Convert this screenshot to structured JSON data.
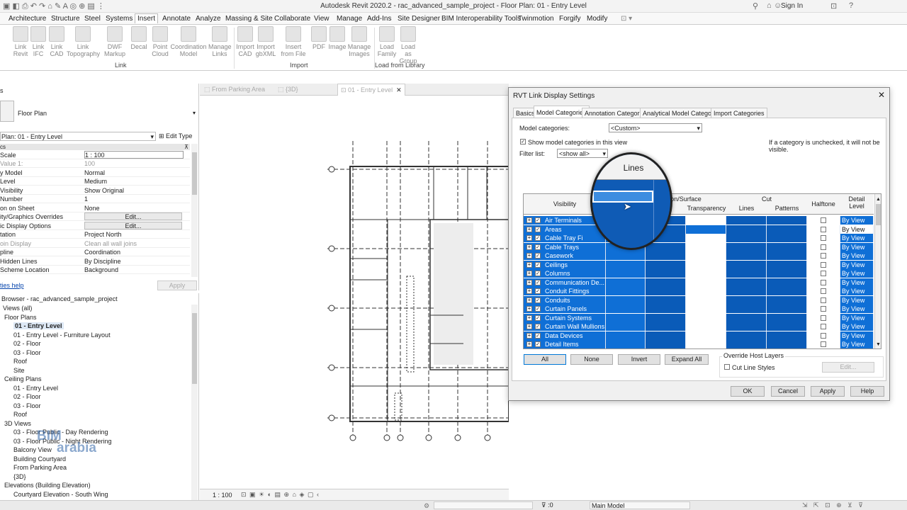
{
  "app": {
    "window_title": "Autodesk Revit 2020.2 - rac_advanced_sample_project - Floor Plan: 01 - Entry Level",
    "sign_in": "Sign In"
  },
  "ribbon_tabs": [
    "Architecture",
    "Structure",
    "Steel",
    "Systems",
    "Insert",
    "Annotate",
    "Analyze",
    "Massing & Site",
    "Collaborate",
    "View",
    "Manage",
    "Add-Ins",
    "Site Designer",
    "BIM Interoperability Tools",
    "Twinmotion",
    "Forgify",
    "Modify"
  ],
  "ribbon": {
    "buttons": [
      {
        "line1": "Link",
        "line2": "Revit"
      },
      {
        "line1": "Link",
        "line2": "IFC"
      },
      {
        "line1": "Link",
        "line2": "CAD"
      },
      {
        "line1": "Link",
        "line2": "Topography"
      },
      {
        "line1": "DWF",
        "line2": "Markup"
      },
      {
        "line1": "Decal",
        "line2": ""
      },
      {
        "line1": "Point",
        "line2": "Cloud"
      },
      {
        "line1": "Coordination",
        "line2": "Model"
      },
      {
        "line1": "Manage",
        "line2": "Links"
      },
      {
        "line1": "Import",
        "line2": "CAD"
      },
      {
        "line1": "Import",
        "line2": "gbXML"
      },
      {
        "line1": "Insert",
        "line2": "from File"
      },
      {
        "line1": "PDF",
        "line2": ""
      },
      {
        "line1": "Image",
        "line2": ""
      },
      {
        "line1": "Manage",
        "line2": "Images"
      },
      {
        "line1": "Load",
        "line2": "Family"
      },
      {
        "line1": "Load as",
        "line2": "Group"
      }
    ],
    "panels": [
      "Link",
      "Import",
      "Load from Library"
    ]
  },
  "properties": {
    "type_name": "Floor Plan",
    "selector": "Plan: 01 - Entry Level",
    "edit_type": "Edit Type",
    "section": "cs",
    "rows": [
      {
        "k": "Scale",
        "v": "1 : 100"
      },
      {
        "k": "Value   1:",
        "v": "100"
      },
      {
        "k": "y Model",
        "v": "Normal"
      },
      {
        "k": "Level",
        "v": "Medium"
      },
      {
        "k": "Visibility",
        "v": "Show Original"
      },
      {
        "k": "Number",
        "v": "1"
      },
      {
        "k": "on on Sheet",
        "v": "None"
      },
      {
        "k": "ity/Graphics Overrides",
        "v": "Edit..."
      },
      {
        "k": "ic Display Options",
        "v": "Edit..."
      },
      {
        "k": "tation",
        "v": "Project North"
      },
      {
        "k": "oin Display",
        "v": "Clean all wall joins"
      },
      {
        "k": "pline",
        "v": "Coordination"
      },
      {
        "k": "Hidden Lines",
        "v": "By Discipline"
      },
      {
        "k": "Scheme Location",
        "v": "Background"
      }
    ],
    "help": "ties help",
    "apply": "Apply"
  },
  "browser": {
    "title": "Browser - rac_advanced_sample_project",
    "nodes": [
      {
        "t": "Views (all)",
        "x": 4
      },
      {
        "t": "Floor Plans",
        "x": 6
      },
      {
        "t": "01 - Entry Level",
        "x": 19,
        "bold": true
      },
      {
        "t": "01 - Entry Level - Furniture Layout",
        "x": 19
      },
      {
        "t": "02 - Floor",
        "x": 19
      },
      {
        "t": "03 - Floor",
        "x": 19
      },
      {
        "t": "Roof",
        "x": 19
      },
      {
        "t": "Site",
        "x": 19
      },
      {
        "t": "Ceiling Plans",
        "x": 6
      },
      {
        "t": "01 - Entry Level",
        "x": 19
      },
      {
        "t": "02 - Floor",
        "x": 19
      },
      {
        "t": "03 - Floor",
        "x": 19
      },
      {
        "t": "Roof",
        "x": 19
      },
      {
        "t": "3D Views",
        "x": 6
      },
      {
        "t": "03 - Floor Public - Day Rendering",
        "x": 19
      },
      {
        "t": "03 - Floor Public - Night Rendering",
        "x": 19
      },
      {
        "t": "Balcony View",
        "x": 19
      },
      {
        "t": "Building Courtyard",
        "x": 19
      },
      {
        "t": "From Parking Area",
        "x": 19
      },
      {
        "t": "{3D}",
        "x": 19
      },
      {
        "t": "Elevations (Building Elevation)",
        "x": 6
      },
      {
        "t": "Courtyard Elevation - South Wing",
        "x": 19
      }
    ],
    "watermark_top": "BIM",
    "watermark_bottom": "arabia"
  },
  "view_tabs": [
    "From Parking Area",
    "{3D}",
    "01 - Entry Level"
  ],
  "view_scale": "1 : 100",
  "status": {
    "main_model": "Main Model",
    "zero": ":0"
  },
  "dialog": {
    "title": "RVT Link Display Settings",
    "tabs": [
      "Basics",
      "Model Categories",
      "Annotation Categories",
      "Analytical Model Categories",
      "Import Categories"
    ],
    "model_categories_label": "Model categories:",
    "model_categories_value": "<Custom>",
    "show_categories_label": "Show model categories in this view",
    "hint": "If a category is unchecked, it will not be visible.",
    "filter_label": "Filter list:",
    "filter_value": "<show all>",
    "headers": {
      "visibility": "Visibility",
      "projection": "on/Surface",
      "lines": "Lines",
      "patterns": "ns",
      "transparency": "Transparency",
      "cut": "Cut",
      "cut_lines": "Lines",
      "cut_patterns": "Patterns",
      "halftone": "Halftone",
      "detail_level": "Detail Level"
    },
    "rows": [
      {
        "name": "Air Terminals",
        "detail": "By View"
      },
      {
        "name": "Areas",
        "detail": "By View"
      },
      {
        "name": "Cable Tray Fi",
        "detail": "By View"
      },
      {
        "name": "Cable Trays",
        "detail": "By View"
      },
      {
        "name": "Casework",
        "detail": "By View"
      },
      {
        "name": "Ceilings",
        "detail": "By View"
      },
      {
        "name": "Columns",
        "detail": "By View"
      },
      {
        "name": "Communication De...",
        "detail": "By View"
      },
      {
        "name": "Conduit Fittings",
        "detail": "By View"
      },
      {
        "name": "Conduits",
        "detail": "By View"
      },
      {
        "name": "Curtain Panels",
        "detail": "By View"
      },
      {
        "name": "Curtain Systems",
        "detail": "By View"
      },
      {
        "name": "Curtain Wall Mullions",
        "detail": "By View"
      },
      {
        "name": "Data Devices",
        "detail": "By View"
      },
      {
        "name": "Detail Items",
        "detail": "By View"
      }
    ],
    "buttons": {
      "all": "All",
      "none": "None",
      "invert": "Invert",
      "expand": "Expand All"
    },
    "override_title": "Override Host Layers",
    "cut_line_styles": "Cut Line Styles",
    "edit": "Edit...",
    "footer": {
      "ok": "OK",
      "cancel": "Cancel",
      "apply": "Apply",
      "help": "Help"
    },
    "magnifier_label": "Lines"
  },
  "colors": {
    "selection": "#0f6fd6",
    "selection_dark": "#0a5bb8",
    "grid_line": "#d6dbe3"
  }
}
